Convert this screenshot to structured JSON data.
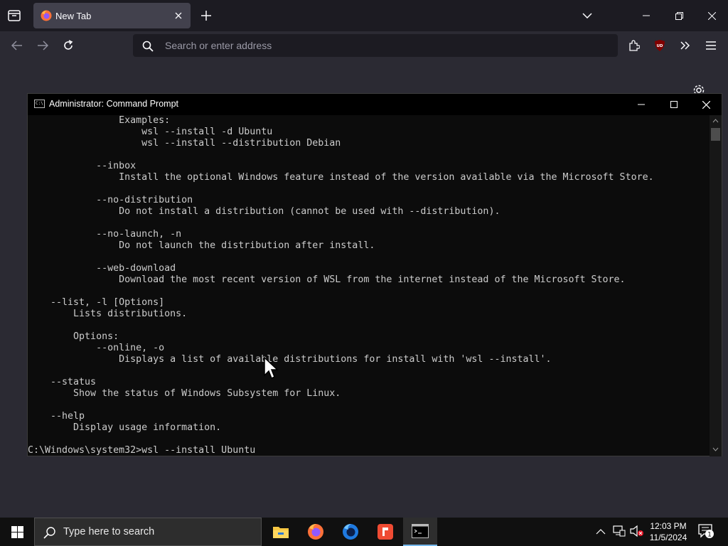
{
  "browser": {
    "tab_title": "New Tab",
    "url_placeholder": "Search or enter address"
  },
  "cmd": {
    "title": "Administrator: Command Prompt",
    "lines": [
      "                Examples:",
      "                    wsl --install -d Ubuntu",
      "                    wsl --install --distribution Debian",
      "",
      "            --inbox",
      "                Install the optional Windows feature instead of the version available via the Microsoft Store.",
      "",
      "            --no-distribution",
      "                Do not install a distribution (cannot be used with --distribution).",
      "",
      "            --no-launch, -n",
      "                Do not launch the distribution after install.",
      "",
      "            --web-download",
      "                Download the most recent version of WSL from the internet instead of the Microsoft Store.",
      "",
      "    --list, -l [Options]",
      "        Lists distributions.",
      "",
      "        Options:",
      "            --online, -o",
      "                Displays a list of available distributions for install with 'wsl --install'.",
      "",
      "    --status",
      "        Show the status of Windows Subsystem for Linux.",
      "",
      "    --help",
      "        Display usage information.",
      "",
      "C:\\Windows\\system32>wsl --install Ubuntu"
    ]
  },
  "taskbar": {
    "search_placeholder": "Type here to search",
    "time": "12:03 PM",
    "date": "11/5/2024",
    "notification_count": "1"
  },
  "colors": {
    "firefox_dark": "#1c1b22",
    "firefox_toolbar": "#2b2a33",
    "cmd_text": "#cccccc",
    "accent": "#76b9ed"
  }
}
